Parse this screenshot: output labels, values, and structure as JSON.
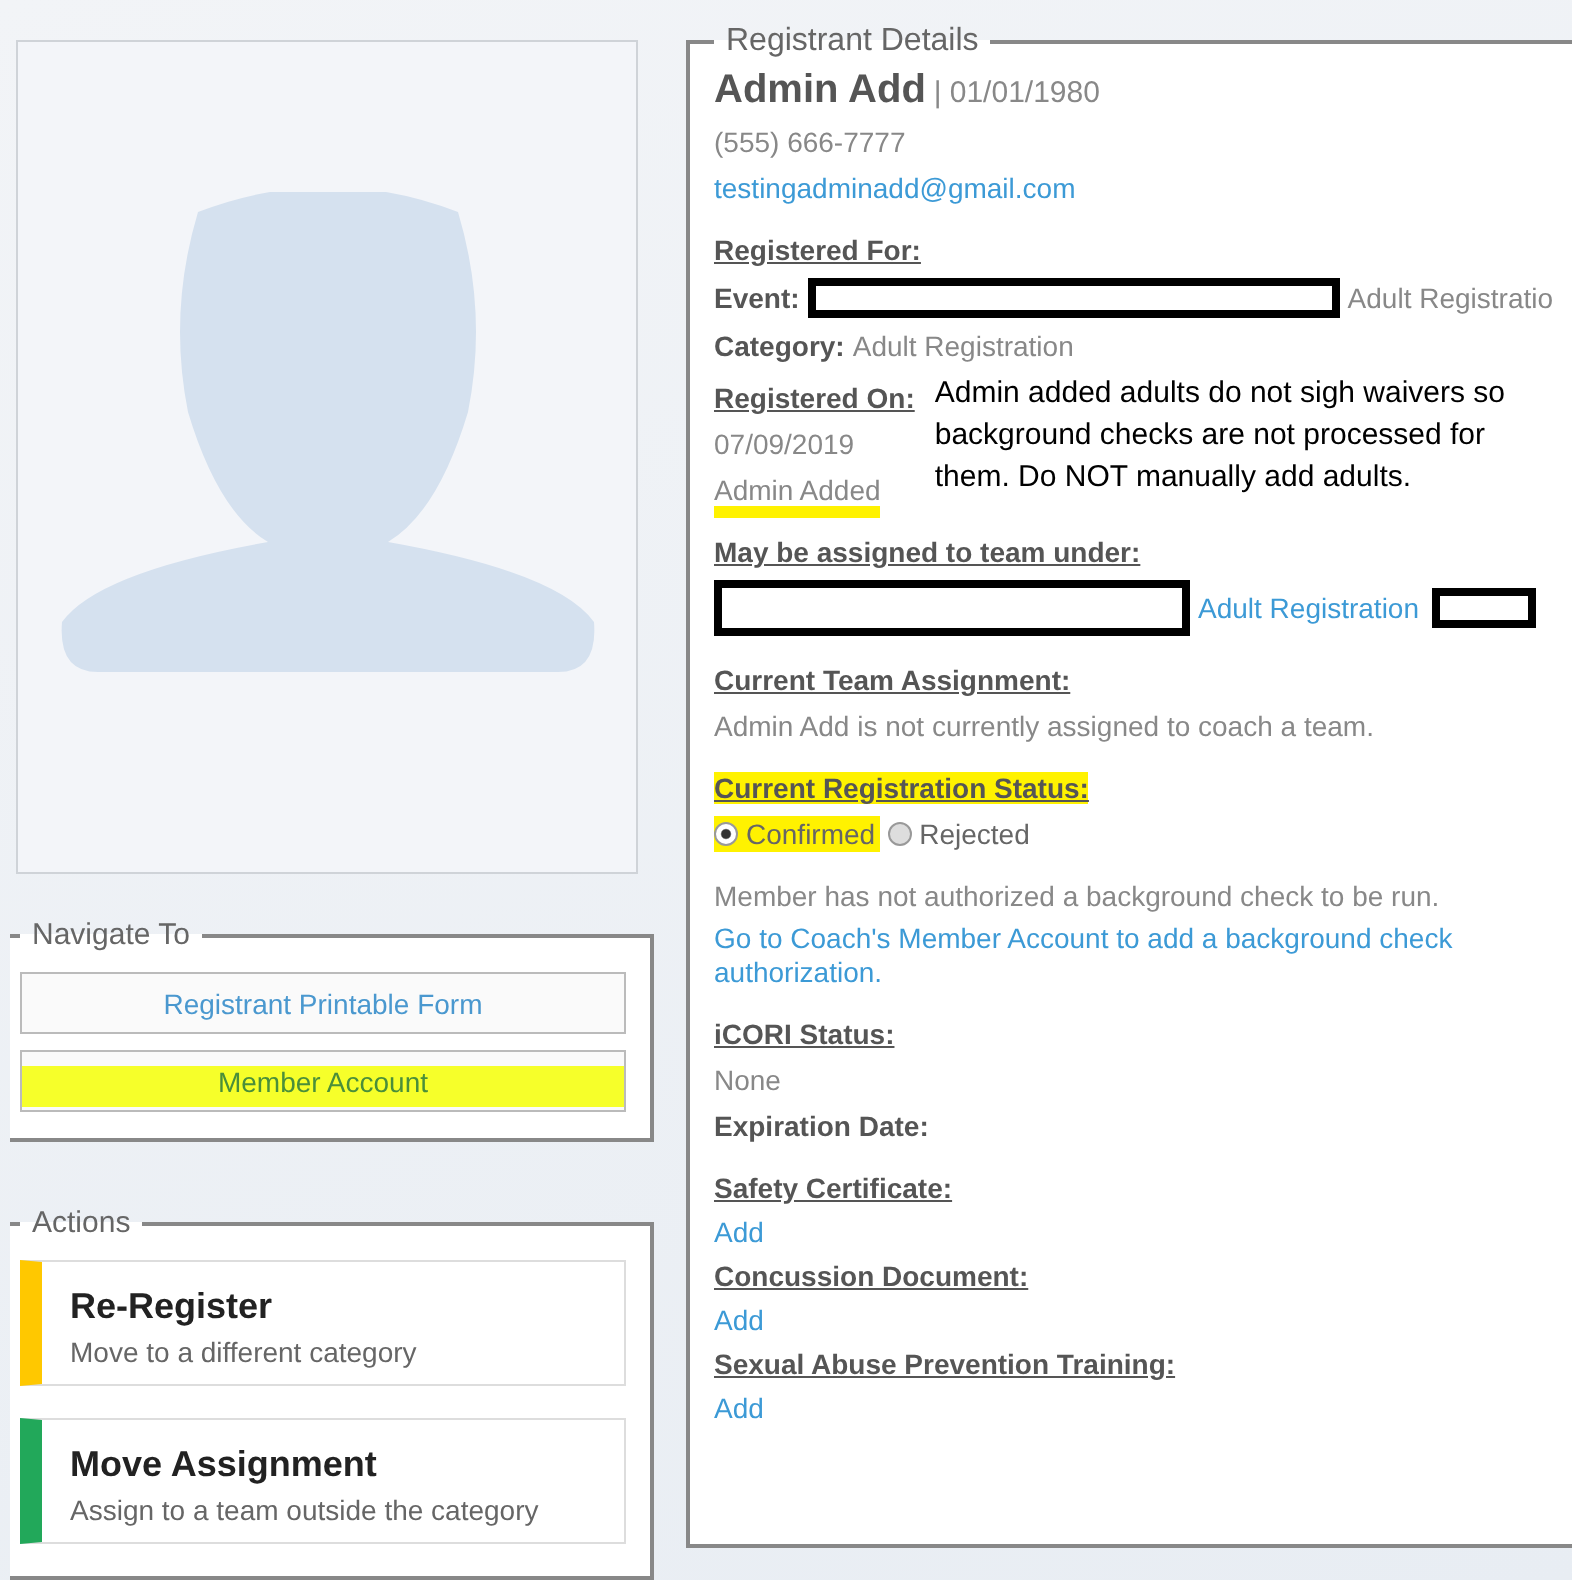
{
  "navigate": {
    "title": "Navigate To",
    "buttons": [
      {
        "label": "Registrant Printable Form",
        "highlighted": false
      },
      {
        "label": "Member Account",
        "highlighted": true
      }
    ]
  },
  "actions": {
    "title": "Actions",
    "items": [
      {
        "title": "Re-Register",
        "description": "Move to a different category",
        "color": "#ffc800"
      },
      {
        "title": "Move Assignment",
        "description": "Assign to a team outside the category",
        "color": "#22a85a"
      }
    ]
  },
  "details": {
    "title": "Registrant Details",
    "name": "Admin Add",
    "birthdate": "| 01/01/1980",
    "phone": "(555) 666-7777",
    "email": "testingadminadd@gmail.com",
    "registered_for": {
      "heading": "Registered For:",
      "event_label": "Event:",
      "event_value": "Adult Registratio",
      "category_label": "Category:",
      "category_value": "Adult Registration"
    },
    "registered_on": {
      "heading": "Registered On:",
      "date": "07/09/2019",
      "source": "Admin Added",
      "source_highlighted": true
    },
    "annotation": "Admin added adults do not sigh waivers so background checks are not processed for them. Do NOT manually add adults.",
    "team_under": {
      "heading": "May be assigned to team under:",
      "link": "Adult Registration"
    },
    "team_assignment": {
      "heading": "Current Team Assignment:",
      "text": "Admin Add is not currently assigned to coach a team."
    },
    "status": {
      "heading": "Current Registration Status:",
      "heading_highlighted": true,
      "options": [
        {
          "label": "Confirmed",
          "selected": true,
          "highlighted": true
        },
        {
          "label": "Rejected",
          "selected": false,
          "highlighted": false
        }
      ]
    },
    "background_note": "Member has not authorized a background check to be run.",
    "background_link": "Go to Coach's Member Account to add a background check authorization.",
    "icori": {
      "heading": "iCORI Status:",
      "value": "None",
      "expiration_label": "Expiration Date:"
    },
    "documents": [
      {
        "heading": "Safety Certificate:",
        "action": "Add"
      },
      {
        "heading": "Concussion Document:",
        "action": "Add"
      },
      {
        "heading": "Sexual Abuse Prevention Training:",
        "action": "Add"
      }
    ]
  }
}
